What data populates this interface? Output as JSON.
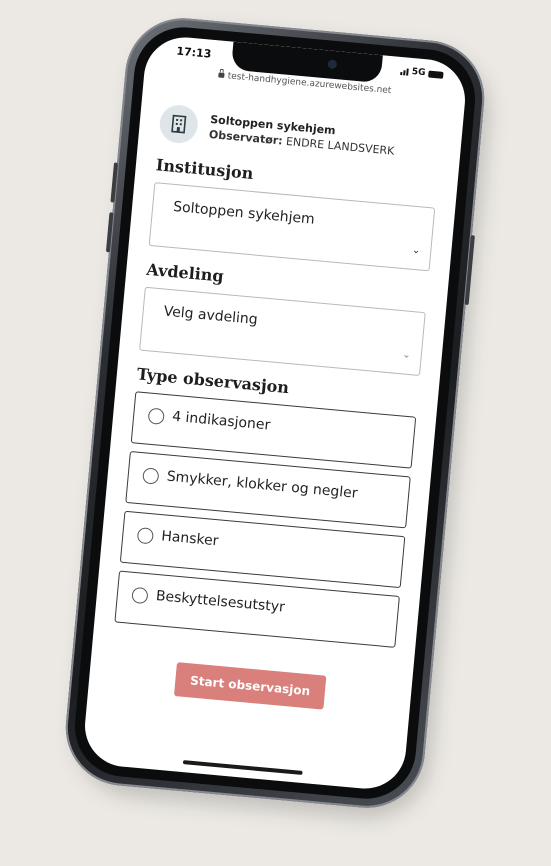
{
  "status_bar": {
    "time": "17:13",
    "network": "5G"
  },
  "browser": {
    "url": "test-handhygiene.azurewebsites.net"
  },
  "institution_header": {
    "name": "Soltoppen sykehjem",
    "observer_label": "Observatør:",
    "observer_name": "ENDRE LANDSVERK",
    "icon": "building-icon"
  },
  "form": {
    "institution": {
      "label": "Institusjon",
      "selected": "Soltoppen sykehjem"
    },
    "department": {
      "label": "Avdeling",
      "placeholder": "Velg avdeling"
    },
    "observation_type": {
      "label": "Type observasjon",
      "options": [
        "4 indikasjoner",
        "Smykker, klokker og negler",
        "Hansker",
        "Beskyttelsesutstyr"
      ]
    },
    "start_label": "Start observasjon"
  },
  "colors": {
    "accent_button": "#d9807c",
    "avatar_bg": "#dfe6ea",
    "background": "#ece9e4"
  }
}
